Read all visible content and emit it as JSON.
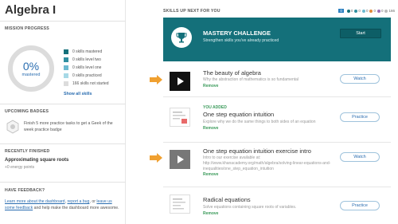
{
  "sidebar": {
    "title": "Algebra I",
    "mission_progress_label": "MISSION PROGRESS",
    "ring": {
      "percent": "0%",
      "label": "mastered",
      "fraction": 0
    },
    "legend": [
      {
        "label": "0 skills mastered",
        "color": "#14707a"
      },
      {
        "label": "0 skills level two",
        "color": "#2f8fa0"
      },
      {
        "label": "0 skills level one",
        "color": "#6cbad0"
      },
      {
        "label": "0 skills practiced",
        "color": "#a7d9e6"
      },
      {
        "label": "166 skills not started",
        "color": "#dcdcdc"
      }
    ],
    "show_all": "Show all skills",
    "upcoming_badges_label": "UPCOMING BADGES",
    "badge_text": "Finish 5 more practice tasks to get a Geek of the week practice badge",
    "recently_finished_label": "RECENTLY FINISHED",
    "recent_title": "Approximating square roots",
    "recent_sub": "+0 energy points",
    "have_feedback_label": "HAVE FEEDBACK?",
    "feedback": {
      "link1": "Learn more about the dashboard",
      "sep1": ", ",
      "link2": "report a bug",
      "sep2": ", or ",
      "link3": "leave us some feedback",
      "tail": " and help make the dashboard more awesome."
    }
  },
  "main": {
    "skills_label": "SKILLS UP NEXT FOR YOU",
    "counts": [
      {
        "value": "0",
        "color": "#2a7fc0"
      },
      {
        "value": "0",
        "color": "#14707a"
      },
      {
        "value": "0",
        "color": "#2f8fa0"
      },
      {
        "value": "0",
        "color": "#6cbad0"
      },
      {
        "value": "0",
        "color": "#e08a3a"
      },
      {
        "value": "0",
        "color": "#9a6bb5"
      },
      {
        "value": "166",
        "color": "#bbbbbb"
      }
    ],
    "mastery": {
      "title": "MASTERY CHALLENGE",
      "subtitle": "Strengthen skills you've already practiced",
      "button": "Start"
    },
    "tasks": [
      {
        "overline": "",
        "title": "The beauty of algebra",
        "desc": "Why the abstraction of mathematics is so fundamental",
        "remove": "Remove",
        "button": "Watch",
        "type": "video"
      },
      {
        "overline": "YOU ADDED",
        "title": "One step equation intuition",
        "desc": "Explore why we do the same things to both sides of an equation",
        "remove": "Remove",
        "button": "Practice",
        "type": "exercise"
      },
      {
        "overline": "",
        "title": "One step equation intuition exercise intro",
        "desc": "Intro to our exercise available at: http://www.khanacademy.org/math/algebra/solving-linear-equations-and-inequalities/one_step_equation_intuition",
        "remove": "Remove",
        "button": "Watch",
        "type": "video"
      },
      {
        "overline": "",
        "title": "Radical equations",
        "desc": "Solve equations containing square roots of variables.",
        "remove": "Remove",
        "button": "Practice",
        "type": "exercise"
      }
    ]
  }
}
